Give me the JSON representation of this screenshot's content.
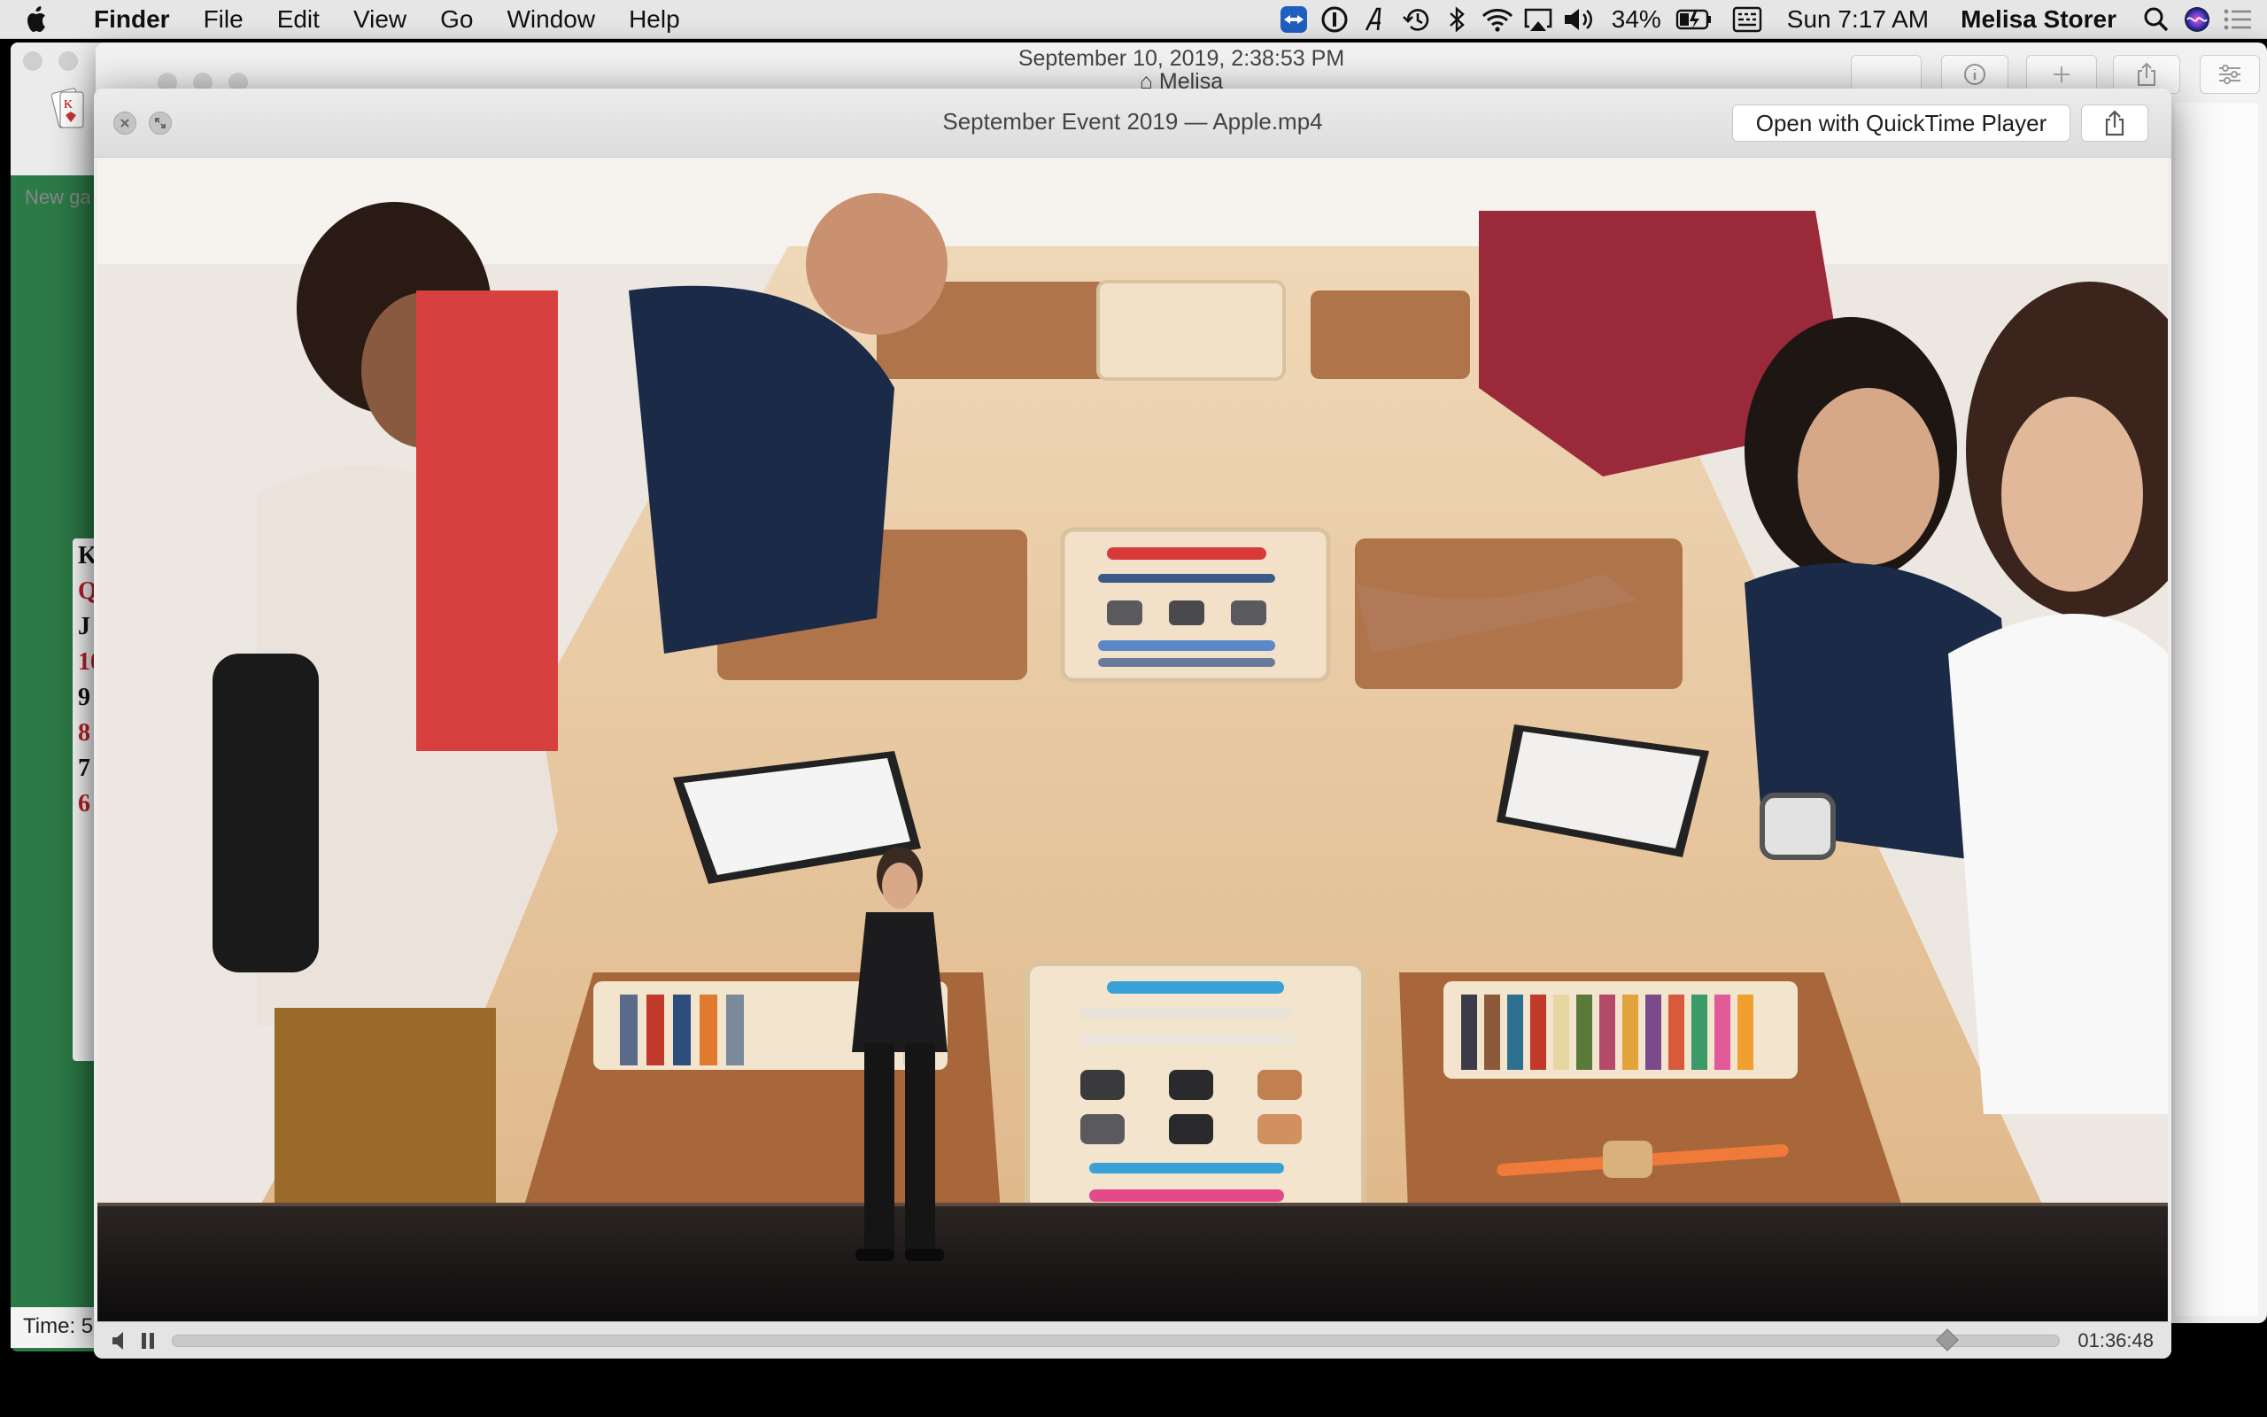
{
  "menubar": {
    "app_name": "Finder",
    "menus": [
      "File",
      "Edit",
      "View",
      "Go",
      "Window",
      "Help"
    ],
    "status": {
      "battery_percent": "34%",
      "clock": "Sun 7:17 AM",
      "user": "Melisa Storer"
    }
  },
  "solitaire": {
    "new_game_label": "New ga",
    "status_text": "Time: 5",
    "cards": [
      "K",
      "Q",
      "J",
      "10",
      "9",
      "8",
      "7",
      "6"
    ]
  },
  "finder": {
    "window_title": "September 10, 2019, 2:38:53 PM",
    "folder_name": "Melisa"
  },
  "quicklook": {
    "title": "September Event 2019 — Apple.mp4",
    "open_with_label": "Open with QuickTime Player",
    "time_remaining": "01:36:48",
    "playback_progress": 0.955
  },
  "colors": {
    "menubar_bg": "#e6e6e6",
    "solitaire_felt": "#2c7a47",
    "table_wood": "#e5c59c",
    "mat_brown": "#a86a3c",
    "stage_floor": "#1a1716"
  }
}
